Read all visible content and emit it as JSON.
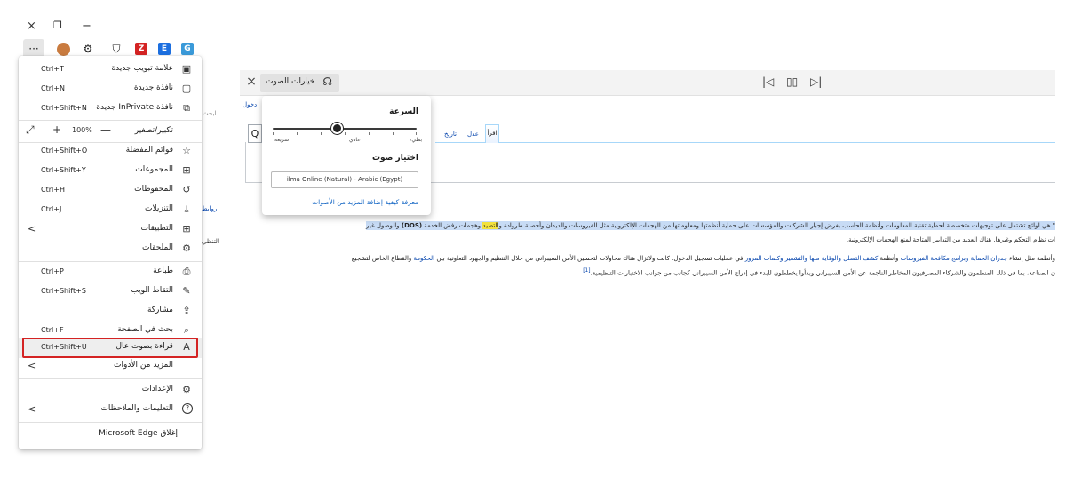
{
  "window_controls": {
    "close": "×",
    "restore": "❐",
    "minimize": "−"
  },
  "toolbar": {
    "more": "···",
    "extensions": [
      {
        "name": "avatar",
        "color": "#c97b3f"
      },
      {
        "name": "extension-icon",
        "glyph": "⚙"
      },
      {
        "name": "shield-extension",
        "glyph": "⛉"
      },
      {
        "name": "z-extension",
        "color": "#d42323",
        "text": "Z"
      },
      {
        "name": "e-extension",
        "color": "#1c6fe0",
        "text": "E"
      },
      {
        "name": "g-extension",
        "color": "#3a9ad9",
        "text": "G"
      }
    ]
  },
  "menu": {
    "items": [
      {
        "shortcut": "Ctrl+T",
        "label": "علامة تبويب جديدة",
        "icon": "▣"
      },
      {
        "shortcut": "Ctrl+N",
        "label": "نافذة جديدة",
        "icon": "▢"
      },
      {
        "shortcut": "Ctrl+Shift+N",
        "label": "نافذة InPrivate جديدة",
        "icon": "⧉"
      },
      {
        "label": "تكبير/تصغير",
        "zoom": "100%",
        "plus": "+",
        "minus": "—",
        "expand": "⤢"
      },
      {
        "shortcut": "Ctrl+Shift+O",
        "label": "قوائم المفضلة",
        "icon": "☆"
      },
      {
        "shortcut": "Ctrl+Shift+Y",
        "label": "المجموعات",
        "icon": "⊞"
      },
      {
        "shortcut": "Ctrl+H",
        "label": "المحفوظات",
        "icon": "↺"
      },
      {
        "shortcut": "Ctrl+J",
        "label": "التنزيلات",
        "icon": "⤓"
      },
      {
        "label": "التطبيقات",
        "icon": "⊞",
        "chevron": "<"
      },
      {
        "label": "الملحقات",
        "icon": "⚙"
      },
      {
        "shortcut": "Ctrl+P",
        "label": "طباعة",
        "icon": "⎙"
      },
      {
        "shortcut": "Ctrl+Shift+S",
        "label": "التقاط الويب",
        "icon": "✎"
      },
      {
        "label": "مشاركة",
        "icon": "⇪"
      },
      {
        "shortcut": "Ctrl+F",
        "label": "بحث في الصفحة",
        "icon": "⌕"
      },
      {
        "shortcut": "Ctrl+Shift+U",
        "label": "قراءة بصوت عال",
        "icon": "A"
      },
      {
        "label": "المزيد من الأدوات",
        "chevron": "<"
      },
      {
        "label": "الإعدادات",
        "icon": "⚙"
      },
      {
        "label": "التعليمات والملاحظات",
        "icon": "?",
        "chevron": "<"
      },
      {
        "label": "إغلاق Microsoft Edge"
      }
    ]
  },
  "read_aloud": {
    "close": "×",
    "voice_options_label": "خيارات الصوت",
    "prev": "|◁",
    "pause": "▯▯",
    "next": "▷|"
  },
  "voice_popup": {
    "speed_title": "السرعة",
    "speed_labels": {
      "slow": "بطيء",
      "normal": "عادي",
      "fast": "سريعة"
    },
    "speed_value": 0.45,
    "voice_title": "اختيار صوت",
    "voice_value": "ilma Online (Natural) - Arabic (Egypt)",
    "learn_more": "معرفة كيفية إضافة المزيد من الأصوات"
  },
  "page": {
    "tabs": {
      "read": "اقرأ",
      "edit": "عدل",
      "history": "تاريخ"
    },
    "search_icon": "Q",
    "peek": {
      "login": "دخول",
      "search_hint": "ابحث",
      "nav": "روابط",
      "tools": "التنظي"
    },
    "line1_pre": "\" هي لوائح تشتمل على توجيهات متخصصة لحماية تقنية المعلومات وأنظمة الحاسب بغرض إجبار الشركات والمؤسسات على حماية أنظمتها ومعلوماتها من الهجمات الإلكترونية مثل الفيروسات والديدان وأحصنة طروادة و",
    "line1_hl": "التصيد",
    "line1_post": " وهجمات رفض الخدمة ",
    "line1_bold": "(DOS)",
    "line1_end": " والوصول غير",
    "line2": "ات نظام التحكم وغيرها. هناك العديد من التدابير المتاحة لمنع الهجمات الإلكترونية.",
    "line3_a": "وأنظمة مثل إنشاء ",
    "line3_link1": "جدران الحماية وبرامج مكافحة الفيروسات",
    "line3_b": " وأنظمة ",
    "line3_link2": "كشف التسلل والوقاية منها والتشفير وكلمات المرور",
    "line3_c": " في عمليات تسجيل الدخول. كانت ولاتزال هناك محاولات لتحسين الأمن السيبراني من خلال التنظيم والجهود التعاونية بين ",
    "line3_link3": "الحكومة",
    "line3_d": " والقطاع الخاص لتشجيع",
    "line4": "ن الصناعة، بما في ذلك المنظمون والشركاء المصرفيون المخاطر الناجمة عن الأمن السيبراني وبدأوا يخططون للبدء في إدراج الأمن السيبراني كجانب من جوانب الاختبارات التنظيمية.",
    "line4_ref": "[1]"
  }
}
